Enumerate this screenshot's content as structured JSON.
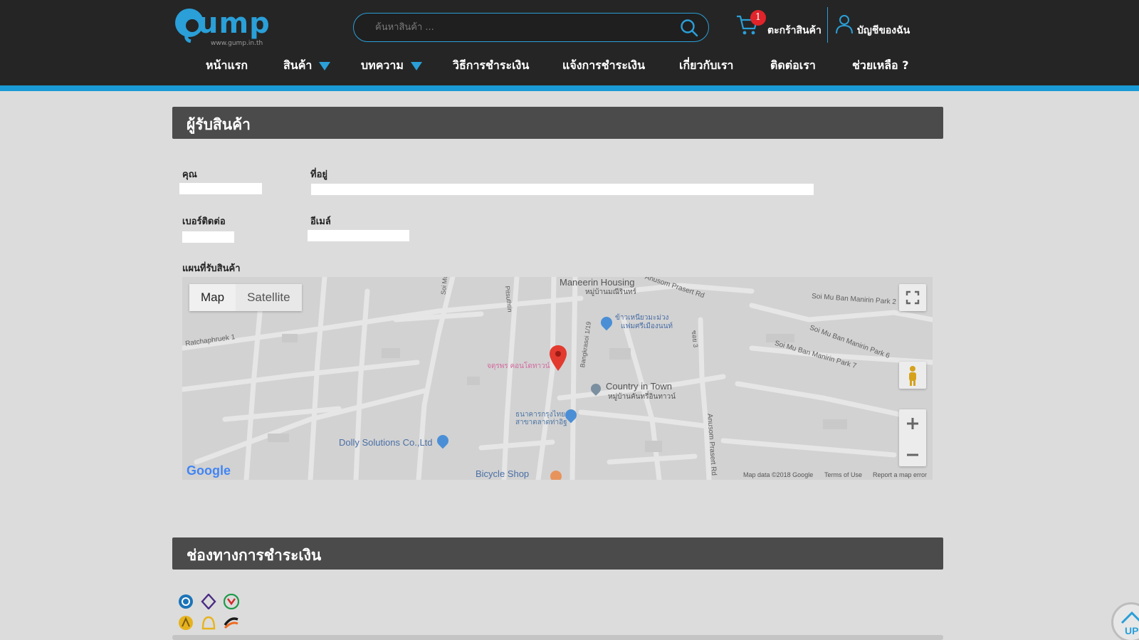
{
  "header": {
    "logo_text": "ump",
    "logo_sub": "www.gump.in.th",
    "search_placeholder": "ค้นหาสินค้า ...",
    "cart_count": "1",
    "cart_label": "ตะกร้าสินค้า",
    "account_label": "บัญชีของฉัน",
    "accent_color": "#2a9fd8"
  },
  "nav": [
    {
      "label": "หน้าแรก"
    },
    {
      "label": "สินค้า"
    },
    {
      "label": "บทความ"
    },
    {
      "label": "วิธีการชำระเงิน"
    },
    {
      "label": "แจ้งการชำระเงิน"
    },
    {
      "label": "เกี่ยวกับเรา"
    },
    {
      "label": "ติดต่อเรา"
    },
    {
      "label": "ช่วยเหลือ ?"
    }
  ],
  "receiver": {
    "title": "ผู้รับสินค้า",
    "name_label": "คุณ",
    "address_label": "ที่อยู่",
    "phone_label": "เบอร์ติดต่อ",
    "email_label": "อีเมล์",
    "map_label": "แผนที่รับสินค้า"
  },
  "map": {
    "type_map": "Map",
    "type_satellite": "Satellite",
    "labels": {
      "maneerin_housing": "Maneerin Housing",
      "maneerin_thai": "หมู่บ้านมณีรินทร์",
      "prasert_rd_top": "Anusom Prasert Rd",
      "soi_mu_ban_2": "Soi Mu Ban Manirin Park 2",
      "soi_mu_ban_6": "Soi Mu Ban Manirin Park 6",
      "soi_mu_ban_7": "Soi Mu Ban Manirin Park 7",
      "ratchaphruek": "Ratchaphruek 1",
      "soi_mu": "Soi Mu",
      "pitsuthtin": "Pitsuthtin",
      "bangkok_rd": "Bangkrasoi 1/19",
      "rice_shop": "ข้าวเหนียวมะม่วง",
      "rice_shop_2": "แฟมศรีเมืองนนท์",
      "pink_place": "จตุรพร คอนโดทาวน์",
      "country_in_town": "Country in Town",
      "country_thai": "หมู่บ้านคันทรี่อินทาวน์",
      "bank_thai": "ธนาคารกรุงไทย",
      "bank_thai_2": "สาขาตลาดท่าอิฐ",
      "dolly": "Dolly Solutions Co.,Ltd",
      "bicycle": "Bicycle Shop",
      "anusom_rd": "Anusom Prasert Rd",
      "soi3": "ซอย 3"
    },
    "google": "Google",
    "map_data": "Map data ©2018 Google",
    "terms": "Terms of Use",
    "report": "Report a map error"
  },
  "payment": {
    "title": "ช่องทางการชำระเงิน",
    "banks": [
      "krungthai-bank-icon",
      "scb-bank-icon",
      "kasikorn-bank-icon",
      "krungsri-bank-icon",
      "bbl-bank-icon",
      "tmb-bank-icon"
    ]
  },
  "scroll_top_label": "UP"
}
